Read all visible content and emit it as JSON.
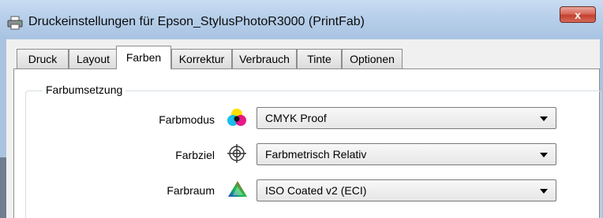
{
  "window": {
    "title": "Druckeinstellungen für Epson_StylusPhotoR3000 (PrintFab)",
    "close_label": "x"
  },
  "tabs": [
    {
      "label": "Druck"
    },
    {
      "label": "Layout"
    },
    {
      "label": "Farben"
    },
    {
      "label": "Korrektur"
    },
    {
      "label": "Verbrauch"
    },
    {
      "label": "Tinte"
    },
    {
      "label": "Optionen"
    }
  ],
  "active_tab": "Farben",
  "group": {
    "label": "Farbumsetzung",
    "rows": [
      {
        "label": "Farbmodus",
        "icon": "color-mode-icon",
        "value": "CMYK Proof"
      },
      {
        "label": "Farbziel",
        "icon": "crosshair-target-icon",
        "value": "Farbmetrisch Relativ"
      },
      {
        "label": "Farbraum",
        "icon": "color-space-triangle-icon",
        "value": "ISO Coated v2 (ECI)"
      }
    ]
  },
  "colors": {
    "title_bar": "#b7cfea",
    "close_button": "#c2412f",
    "group_border": "#d5dfe5"
  }
}
